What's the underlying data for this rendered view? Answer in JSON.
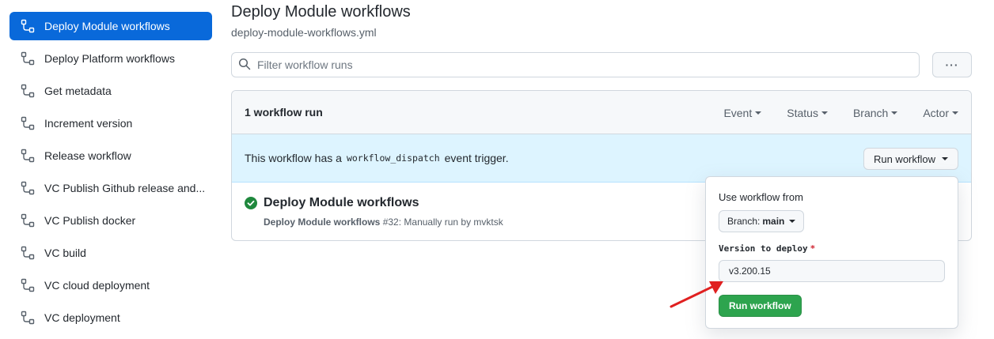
{
  "sidebar": {
    "items": [
      {
        "label": "Deploy Module workflows",
        "active": true
      },
      {
        "label": "Deploy Platform workflows",
        "active": false
      },
      {
        "label": "Get metadata",
        "active": false
      },
      {
        "label": "Increment version",
        "active": false
      },
      {
        "label": "Release workflow",
        "active": false
      },
      {
        "label": "VC Publish Github release and...",
        "active": false
      },
      {
        "label": "VC Publish docker",
        "active": false
      },
      {
        "label": "VC build",
        "active": false
      },
      {
        "label": "VC cloud deployment",
        "active": false
      },
      {
        "label": "VC deployment",
        "active": false
      }
    ]
  },
  "main": {
    "title": "Deploy Module workflows",
    "filename": "deploy-module-workflows.yml",
    "filter_placeholder": "Filter workflow runs",
    "more_button": "···",
    "runs_count": "1 workflow run",
    "filters": [
      "Event",
      "Status",
      "Branch",
      "Actor"
    ],
    "dispatch": {
      "prefix": "This workflow has a",
      "code": "workflow_dispatch",
      "suffix": "event trigger.",
      "run_button": "Run workflow"
    },
    "run": {
      "title": "Deploy Module workflows",
      "workflow_name": "Deploy Module workflows",
      "detail": "#32: Manually run by mvktsk",
      "status": "success"
    }
  },
  "popover": {
    "use_from_label": "Use workflow from",
    "branch_prefix": "Branch:",
    "branch_value": "main",
    "version_label": "Version to deploy",
    "required_mark": "*",
    "version_value": "v3.200.15",
    "submit_label": "Run workflow"
  },
  "colors": {
    "accent": "#0969da",
    "success": "#1f883d",
    "primary_button": "#2da44e",
    "info_bg": "#ddf4ff",
    "annotation_arrow": "#e02020"
  }
}
